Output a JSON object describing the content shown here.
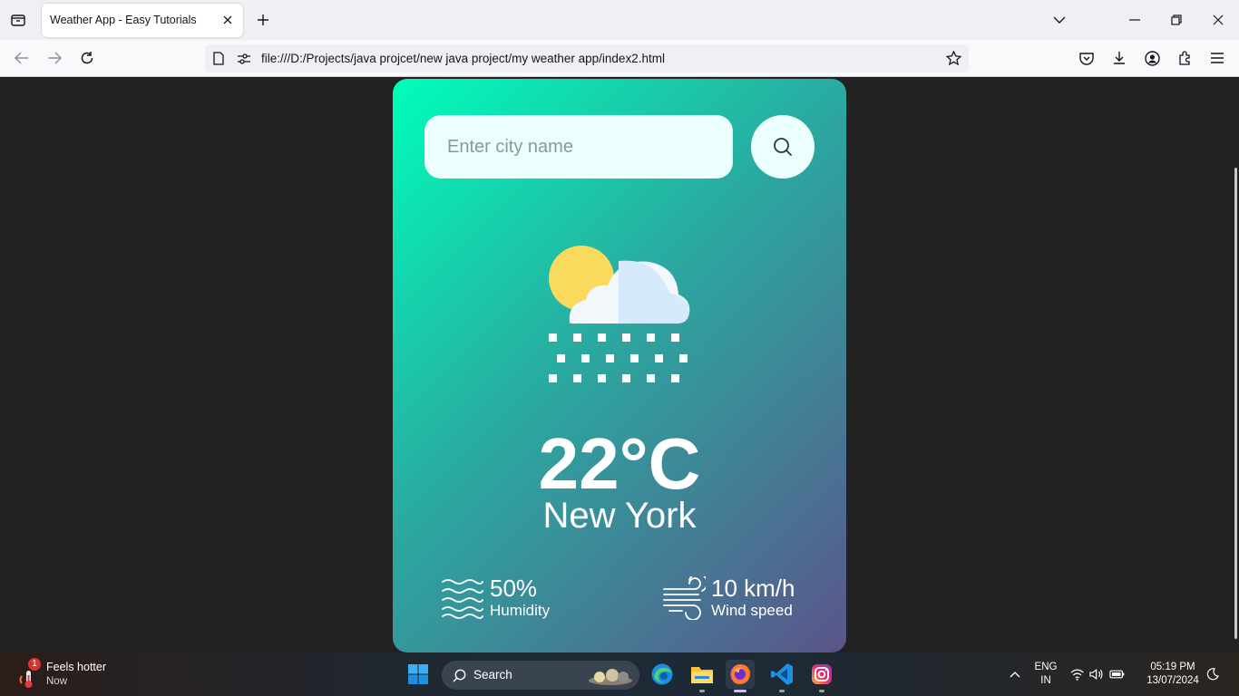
{
  "browser": {
    "tab_title": "Weather App - Easy Tutorials",
    "url": "file:///D:/Projects/java projcet/new java project/my weather app/index2.html"
  },
  "app": {
    "search_placeholder": "Enter city name",
    "temperature": "22°C",
    "city": "New York",
    "humidity_value": "50%",
    "humidity_label": "Humidity",
    "wind_value": "10 km/h",
    "wind_label": "Wind speed",
    "condition_icon": "snow-cloud-sun-icon"
  },
  "taskbar": {
    "weather_title": "Feels hotter",
    "weather_sub": "Now",
    "weather_badge": "1",
    "search_label": "Search",
    "lang_top": "ENG",
    "lang_bottom": "IN",
    "time": "05:19 PM",
    "date": "13/07/2024"
  },
  "colors": {
    "card_gradient_start": "#00feba",
    "card_gradient_end": "#5b548a",
    "page_background": "#222222"
  }
}
